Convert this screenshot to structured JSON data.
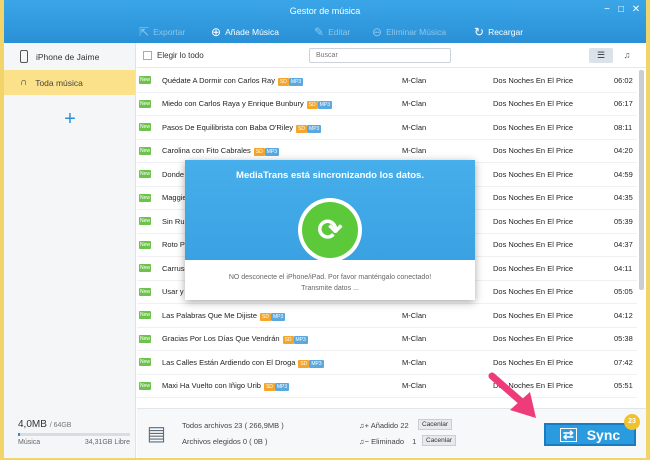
{
  "window": {
    "title": "Gestor de música",
    "controls": [
      "−",
      "□",
      "✕"
    ]
  },
  "toolbar": {
    "export_label": "Exportar",
    "add_label": "Añade Música",
    "edit_label": "Editar",
    "delete_label": "Eliminar Música",
    "refresh_label": "Recargar"
  },
  "sidebar": {
    "device_name": "iPhone de Jaime",
    "items": [
      {
        "label": "Toda música"
      }
    ],
    "add_symbol": "+",
    "storage": {
      "used": "4,0MB",
      "total": "/ 64GB",
      "label": "Música",
      "free": "34,31GB Libre",
      "fill_fraction": 0.02
    }
  },
  "list_header": {
    "select_all_label": "Elegir lo todo",
    "search_placeholder": "Buscar"
  },
  "badges": {
    "new": "New",
    "sd": "SD",
    "mp3": "MP3"
  },
  "songs": [
    {
      "title": "Quédate A Dormir con Carlos Ray",
      "artist": "M-Clan",
      "album": "Dos Noches En El Price",
      "time": "06:02"
    },
    {
      "title": "Miedo con Carlos Raya y Enrique Bunbury",
      "artist": "M-Clan",
      "album": "Dos Noches En El Price",
      "time": "06:17"
    },
    {
      "title": "Pasos De Equilibrista con Baba O'Riley",
      "artist": "M-Clan",
      "album": "Dos Noches En El Price",
      "time": "08:11"
    },
    {
      "title": "Carolina con Fito Cabrales",
      "artist": "M-Clan",
      "album": "Dos Noches En El Price",
      "time": "04:20"
    },
    {
      "title": "Donde",
      "artist": "M-Clan",
      "album": "Dos Noches En El Price",
      "time": "04:59"
    },
    {
      "title": "Maggie",
      "artist": "M-Clan",
      "album": "Dos Noches En El Price",
      "time": "04:35"
    },
    {
      "title": "Sin Rum",
      "artist": "M-Clan",
      "album": "Dos Noches En El Price",
      "time": "05:39"
    },
    {
      "title": "Roto Po",
      "artist": "M-Clan",
      "album": "Dos Noches En El Price",
      "time": "04:37"
    },
    {
      "title": "Carruse",
      "artist": "M-Clan",
      "album": "Dos Noches En El Price",
      "time": "04:11"
    },
    {
      "title": "Usar y T",
      "artist": "M-Clan",
      "album": "Dos Noches En El Price",
      "time": "05:05"
    },
    {
      "title": "Las Palabras Que Me Dijiste",
      "artist": "M-Clan",
      "album": "Dos Noches En El Price",
      "time": "04:12"
    },
    {
      "title": "Gracias Por Los Días Que Vendrán",
      "artist": "M-Clan",
      "album": "Dos Noches En El Price",
      "time": "05:38"
    },
    {
      "title": "Las Calles Están Ardiendo con El Droga",
      "artist": "M-Clan",
      "album": "Dos Noches En El Price",
      "time": "07:42"
    },
    {
      "title": "Maxi Ha Vuelto con Iñigo Urib",
      "artist": "M-Clan",
      "album": "Dos Noches En El Price",
      "time": "05:51"
    }
  ],
  "sync_dialog": {
    "title": "MediaTrans está sincronizando los datos.",
    "line1": "NO desconecte el iPhone/iPad. Por favor manténgalo conectado!",
    "line2": "Transmite datos ..."
  },
  "footer": {
    "total_label": "Todos archivos",
    "total_count": "23",
    "total_size": "( 266,9MB )",
    "selected_label": "Archivos elegidos",
    "selected_count": "0",
    "selected_size": "( 0B )",
    "added_label": "Añadido",
    "added_count": "22",
    "removed_label": "Eliminado",
    "removed_count": "1",
    "cancel_label": "Cacenlar"
  },
  "sync_button": {
    "label": "Sync",
    "badge": "23"
  },
  "colors": {
    "accent": "#2a90d6",
    "selected": "#fbe28a",
    "new_badge": "#6cc24a",
    "sync_green": "#5cc93a",
    "arrow": "#ee3b7a"
  }
}
